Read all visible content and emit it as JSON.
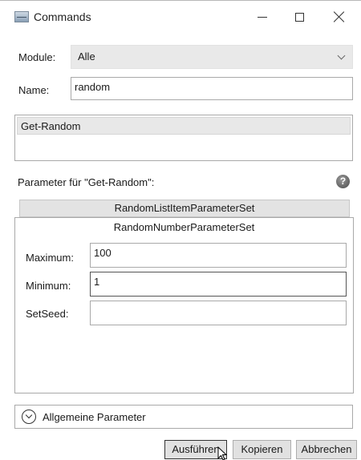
{
  "window": {
    "title": "Commands",
    "minimize_label": "—",
    "maximize_label": "",
    "close_label": ""
  },
  "filter": {
    "module_label": "Module:",
    "module_value": "Alle",
    "name_label": "Name:",
    "name_value": "random"
  },
  "command_list": {
    "items": [
      "Get-Random"
    ]
  },
  "parameters": {
    "heading": "Parameter für \"Get-Random\":",
    "help_icon": "?",
    "tabs": [
      "RandomListItemParameterSet",
      "RandomNumberParameterSet"
    ],
    "active_tab": "RandomNumberParameterSet",
    "fields": [
      {
        "label": "Maximum:",
        "value": "100"
      },
      {
        "label": "Minimum:",
        "value": "1"
      },
      {
        "label": "SetSeed:",
        "value": ""
      }
    ]
  },
  "common_parameters": {
    "label": "Allgemeine Parameter"
  },
  "buttons": {
    "run": "Ausführen",
    "copy": "Kopieren",
    "cancel": "Abbrechen"
  },
  "colors": {
    "selection_bg": "#e8e8e8",
    "tab_header_bg": "#e3e3e3",
    "button_bg": "#e1e1e1"
  }
}
